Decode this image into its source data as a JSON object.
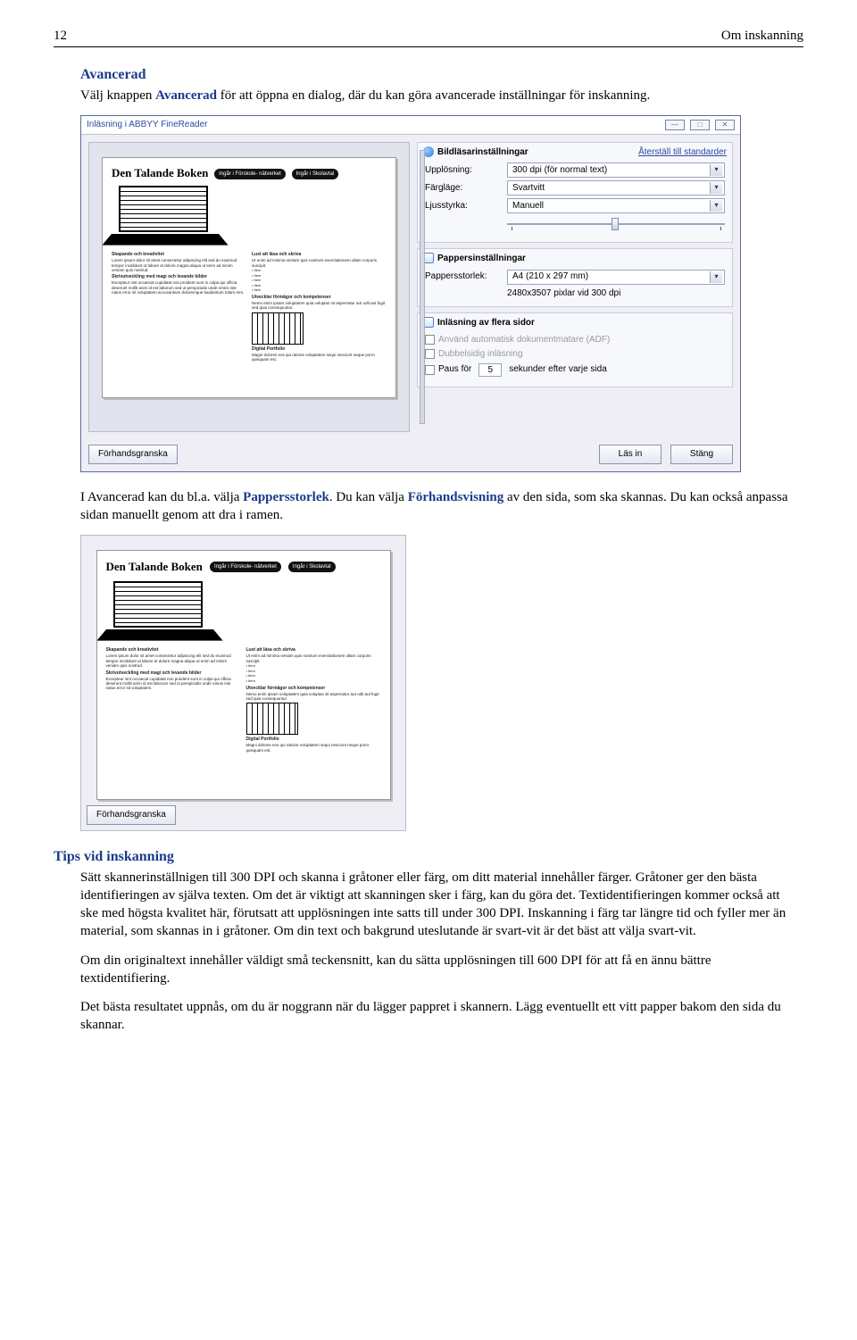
{
  "header": {
    "pageno": "12",
    "title": "Om inskanning"
  },
  "sec1": {
    "heading": "Avancerad",
    "p1a": "Välj knappen ",
    "p1b": "Avancerad",
    "p1c": " för att öppna en dialog, där du kan göra avancerade inställningar för inskanning."
  },
  "dialog": {
    "title": "Inläsning i ABBYY FineReader",
    "preview_title": "Den Talande Boken",
    "pill1": "Ingår i\nFörskole-\nnätverket",
    "pill2": "Ingår i\nSkolavtal",
    "thumb_h1": "Skapande och kreativitet",
    "thumb_h2": "Skrivutveckling med magi\noch levande bilder",
    "thumb_h3": "Lust att läsa och skriva",
    "thumb_h4": "Utvecklar förmågor och\nkompetenser",
    "thumb_h5": "Digital Portfolio",
    "grp1": "Bildläsarinställningar",
    "reset": "Återställ till standarder",
    "res_lbl": "Upplösning:",
    "res_val": "300 dpi (för normal text)",
    "col_lbl": "Färgläge:",
    "col_val": "Svartvitt",
    "bri_lbl": "Ljusstyrka:",
    "bri_val": "Manuell",
    "grp2": "Pappersinställningar",
    "size_lbl": "Pappersstorlek:",
    "size_val": "A4 (210 x 297 mm)",
    "px_note": "2480x3507 pixlar vid 300 dpi",
    "grp3": "Inläsning av flera sidor",
    "adf": "Använd automatisk dokumentmatare (ADF)",
    "duplex": "Dubbelsidig inläsning",
    "pause1": "Paus för",
    "pause_n": "5",
    "pause2": "sekunder efter varje sida",
    "btn_preview": "Förhandsgranska",
    "btn_scan": "Läs in",
    "btn_close": "Stäng"
  },
  "mid": {
    "p1a": "I Avancerad kan du bl.a. välja ",
    "p1b": "Pappersstorlek",
    "p1c": ". Du kan välja ",
    "p1d": "Förhandsvisning",
    "p1e": " av den sida, som ska skannas. Du kan också anpassa sidan manuellt genom att dra i ramen."
  },
  "tips": {
    "heading": "Tips vid inskanning",
    "p1": "Sätt skannerinställnigen till 300 DPI och skanna i gråtoner eller färg, om ditt material innehåller färger. Gråtoner ger den bästa identifieringen av själva texten. Om det är viktigt att skanningen sker i färg, kan du göra det. Textidentifieringen kommer också att ske med högsta kvalitet här, förutsatt att upplösningen inte satts till under 300 DPI. Inskanning i färg tar längre tid och fyller mer än material, som skannas in i gråtoner. Om din text och bakgrund uteslutande är svart-vit är det bäst att välja svart-vit.",
    "p2": "Om din originaltext innehåller väldigt små teckensnitt, kan du sätta upplösningen till 600 DPI för att få en ännu bättre textidentifiering.",
    "p3": "Det bästa resultatet uppnås, om du är noggrann när du lägger pappret i skannern. Lägg eventuellt ett vitt papper bakom den sida du skannar."
  }
}
